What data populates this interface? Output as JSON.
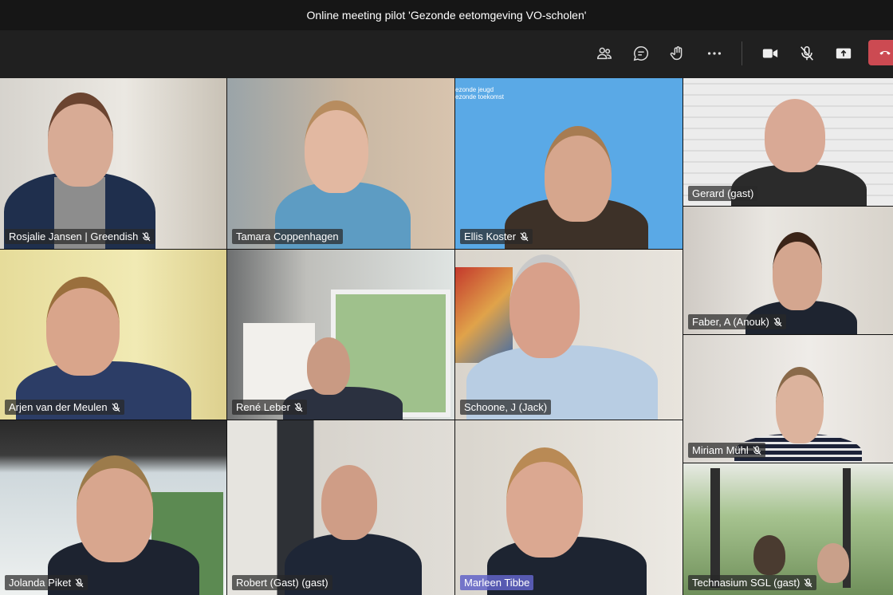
{
  "meeting": {
    "title": "Online meeting pilot 'Gezonde eetomgeving VO-scholen'"
  },
  "toolbar": {
    "buttons": [
      {
        "icon": "people-icon"
      },
      {
        "icon": "chat-icon"
      },
      {
        "icon": "raise-hand-icon"
      },
      {
        "icon": "more-options-icon"
      },
      {
        "icon": "camera-icon"
      },
      {
        "icon": "mic-muted-icon"
      },
      {
        "icon": "share-screen-icon"
      },
      {
        "icon": "hang-up-icon"
      }
    ],
    "hangup_color": "#cc4a52"
  },
  "background_banner": {
    "line1": "ezonde jeugd",
    "line2": "ezonde toekomst"
  },
  "participants": [
    {
      "name": "Rosjalie Jansen | Greendish",
      "muted": true
    },
    {
      "name": "Tamara Coppenhagen",
      "muted": false
    },
    {
      "name": "Ellis Koster",
      "muted": true
    },
    {
      "name": "Gerard (gast)",
      "muted": false
    },
    {
      "name": "Faber, A (Anouk)",
      "muted": true
    },
    {
      "name": "Arjen van der Meulen",
      "muted": true
    },
    {
      "name": "René Leber",
      "muted": true
    },
    {
      "name": "Schoone, J (Jack)",
      "muted": false
    },
    {
      "name": "Miriam Mühl",
      "muted": true
    },
    {
      "name": "Jolanda Piket",
      "muted": true
    },
    {
      "name": "Robert (Gast) (gast)",
      "muted": false
    },
    {
      "name": "Marleen Tibbe",
      "muted": false,
      "speaking": true
    },
    {
      "name": "Technasium SGL (gast)",
      "muted": true
    }
  ],
  "colors": {
    "speaking_highlight": "#6264c8",
    "banner_blue": "#5aa9e6"
  }
}
